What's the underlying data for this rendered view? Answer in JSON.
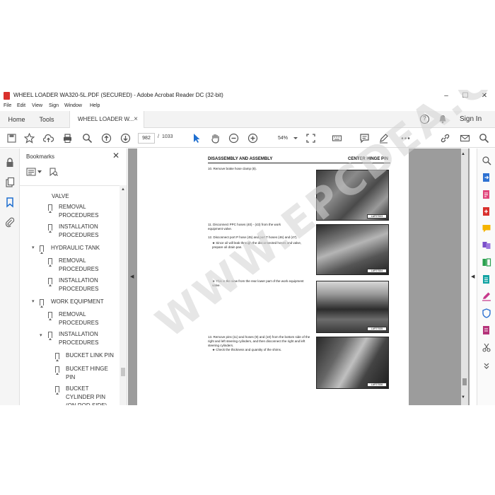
{
  "window": {
    "title": "WHEEL LOADER WA320-5L.PDF (SECURED) - Adobe Acrobat Reader DC (32-bit)",
    "minimize": "–",
    "maximize": "☐",
    "close": "✕"
  },
  "menu": [
    "File",
    "Edit",
    "View",
    "Sign",
    "Window",
    "Help"
  ],
  "tabs": {
    "home": "Home",
    "tools": "Tools",
    "document": "WHEEL LOADER W...",
    "doc_close": "×",
    "sign_in": "Sign In",
    "help": "?"
  },
  "toolbar": {
    "page_current": "982",
    "page_sep": "/",
    "page_total": "1033",
    "zoom": "54%"
  },
  "bookmarks": {
    "title": "Bookmarks",
    "close": "✕",
    "items": [
      {
        "label": "VALVE"
      },
      {
        "label": "REMOVAL PROCEDURES"
      },
      {
        "label": "INSTALLATION PROCEDURES"
      },
      {
        "label": "HYDRAULIC TANK"
      },
      {
        "label": "REMOVAL PROCEDURES"
      },
      {
        "label": "INSTALLATION PROCEDURES"
      },
      {
        "label": "WORK EQUIPMENT"
      },
      {
        "label": "REMOVAL PROCEDURES"
      },
      {
        "label": "INSTALLATION PROCEDURES"
      },
      {
        "label": "BUCKET LINK PIN"
      },
      {
        "label": "BUCKET HINGE PIN"
      },
      {
        "label": "BUCKET CYLINDER PIN (ON ROD SIDE)"
      }
    ]
  },
  "document": {
    "header_left": "DISASSEMBLY AND ASSEMBLY",
    "header_right": "CENTER HINGE PIN",
    "steps": [
      "10. Remove brake hose clamp (8).",
      "11. Disconnect PPC hoses (40) - (43) from the work equipment valve.",
      "12. Disconnect port P hose (45) and port T hoses (46) and (47).",
      "★ Since oil will leak through the disconnected hoses and valve, prepare oil drain pan.",
      "★ This is the view from the rear lower part of the work equipment valve.",
      "13. Remove pins (11) and hoses (9) and (10) from the bottom side of the right and left steering cylinders, and then disconnect the right and left steering cylinders.",
      "★ Check the thickness and quantity of the shims."
    ],
    "photo_labels": [
      "LAP27533",
      "LAP27534",
      "LAP27535",
      "LAP27536"
    ],
    "watermark": "WWW.EPCDEA.COM"
  }
}
